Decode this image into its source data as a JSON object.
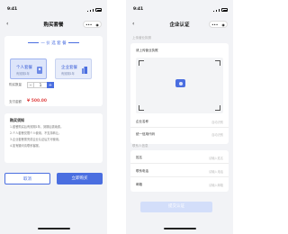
{
  "left": {
    "status_time": "9:41",
    "nav_title": "购买套餐",
    "back_icon": "‹",
    "capsule": {
      "more": "•••",
      "close": "◉"
    },
    "section_title": "一 价 选 套 餐",
    "packages": [
      {
        "name": "个人套餐",
        "sub": "有效期1年",
        "selected": true
      },
      {
        "name": "企业套餐",
        "sub": "有效期1年",
        "selected": false
      }
    ],
    "quantity_label": "购买数量",
    "quantity_value": "1",
    "minus": "-",
    "plus": "+",
    "price_label": "支付金额",
    "price_value": "¥ 500.00",
    "notes_title": "购买须知",
    "notes": [
      "1.套餐购买后有效期1年，到期后需续费。",
      "2.个人套餐仅限个人使用，不支持转让。",
      "3.企业套餐需完成企业认证后方可使用。",
      "4.如有疑问请联系客服。"
    ],
    "cancel_label": "取消",
    "buy_label": "立即购买"
  },
  "right": {
    "status_time": "9:41",
    "nav_title": "企业认证",
    "back_icon": "‹",
    "capsule": {
      "more": "•••",
      "close": "◉"
    },
    "group1": "上传营业执照",
    "upload_hint": "请上传营业执照",
    "fields1": [
      {
        "label": "企业名称",
        "value": "自动识别"
      },
      {
        "label": "统一信用代码",
        "value": "自动识别"
      }
    ],
    "group2": "联系人信息",
    "fields2": [
      {
        "label": "姓名",
        "value": "请输入姓名"
      },
      {
        "label": "联系电话",
        "value": "请输入电话"
      },
      {
        "label": "邮箱",
        "value": "请输入邮箱"
      }
    ],
    "submit_label": "提交认证"
  },
  "colors": {
    "accent": "#4a6ee0",
    "price": "#e04848"
  }
}
